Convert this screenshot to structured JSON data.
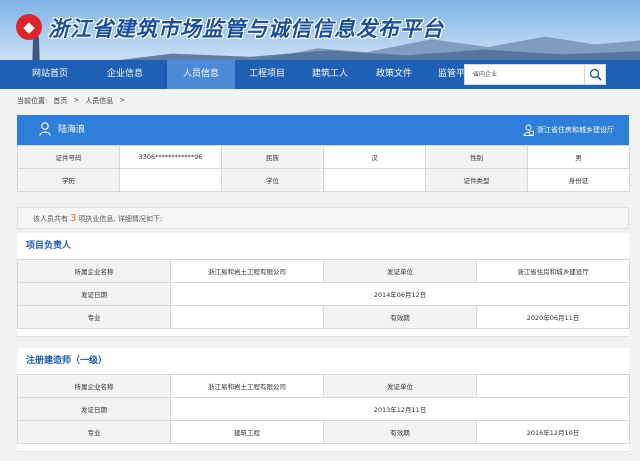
{
  "site": {
    "logo_glyph": "◆",
    "title": "浙江省建筑市场监管与诚信信息发布平台"
  },
  "nav": {
    "items": [
      {
        "label": "网站首页",
        "active": false
      },
      {
        "label": "企业信息",
        "active": false
      },
      {
        "label": "人员信息",
        "active": true
      },
      {
        "label": "工程项目",
        "active": false
      },
      {
        "label": "建筑工人",
        "active": false
      },
      {
        "label": "政策文件",
        "active": false
      },
      {
        "label": "监管平台",
        "active": false
      }
    ],
    "search_scope": "省内企业",
    "search_icon": "search-icon"
  },
  "breadcrumb": {
    "prefix": "当前位置:",
    "items": [
      "首页",
      ">",
      "人员信息",
      ">"
    ]
  },
  "person": {
    "name": "陆海浪",
    "org": "浙江省住房和城乡建设厅"
  },
  "basic_info": [
    [
      "证件号码",
      "3306************96",
      "民族",
      "汉",
      "性别",
      "男"
    ],
    [
      "学历",
      "",
      "学位",
      "",
      "证件类型",
      "身份证"
    ]
  ],
  "summary": {
    "before": "该人员共有",
    "count": "3",
    "after": "项执业信息, 详细情况如下:"
  },
  "sections": [
    {
      "title": "项目负责人",
      "rows": [
        [
          "所属企业名称",
          "浙江易和岩土工程有限公司",
          "发证单位",
          "浙江省住房和城乡建设厅"
        ],
        [
          "发证日期",
          "2014年06月12日"
        ],
        [
          "专业",
          "",
          "有效期",
          "2020年06月11日"
        ]
      ]
    },
    {
      "title": "注册建造师（一级）",
      "rows": [
        [
          "所属企业名称",
          "浙江易和岩土工程有限公司",
          "发证单位",
          ""
        ],
        [
          "发证日期",
          "2013年12月11日"
        ],
        [
          "专业",
          "建筑工程",
          "有效期",
          "2016年12月10日"
        ]
      ]
    }
  ]
}
